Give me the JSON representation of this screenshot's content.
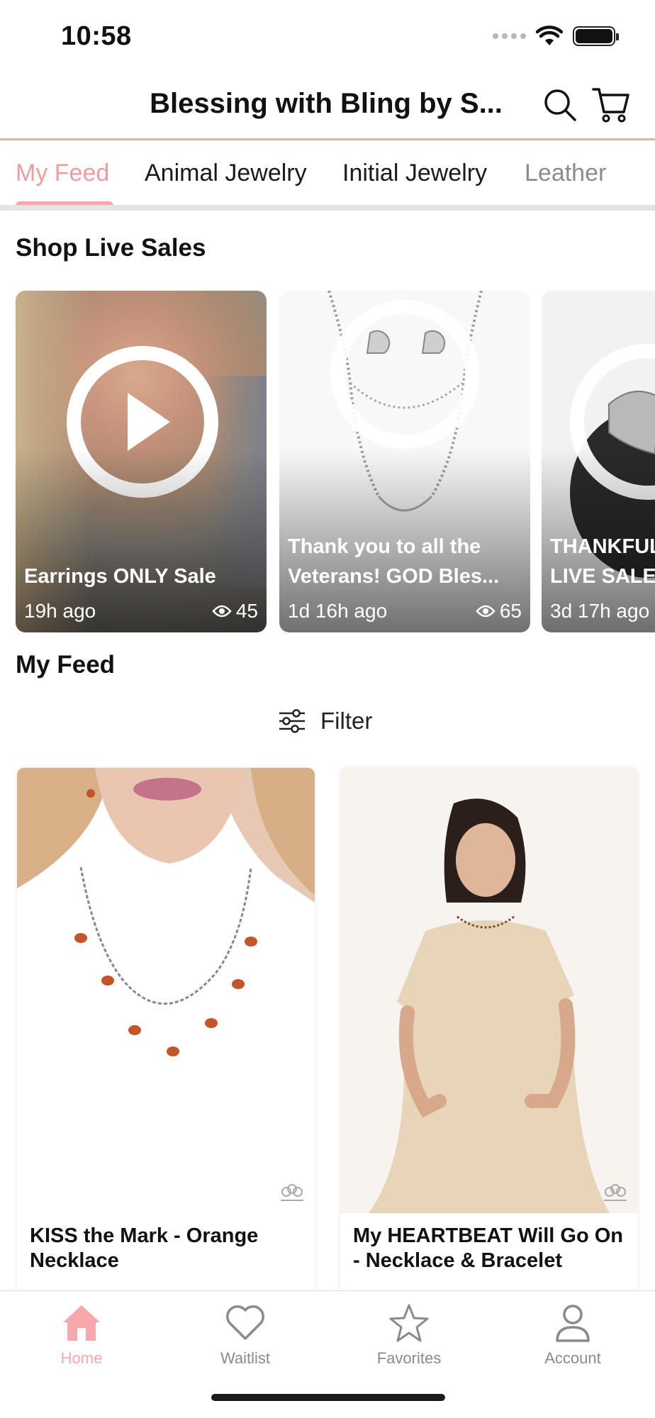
{
  "status_bar": {
    "time": "10:58"
  },
  "header": {
    "store_title": "Blessing with Bling by S...",
    "search_icon": "search-icon",
    "cart_icon": "cart-icon"
  },
  "tabs": [
    {
      "label": "My Feed",
      "active": true
    },
    {
      "label": "Animal Jewelry",
      "active": false
    },
    {
      "label": "Initial Jewelry",
      "active": false
    },
    {
      "label": "Leather",
      "active": false
    }
  ],
  "live_sales": {
    "section_title": "Shop Live Sales",
    "cards": [
      {
        "title_lines": [
          "Earrings ONLY Sale"
        ],
        "time": "19h ago",
        "views": "45"
      },
      {
        "title_lines": [
          "Thank you to all the",
          "Veterans! GOD Bles..."
        ],
        "time": "1d 16h ago",
        "views": "65"
      },
      {
        "title_lines": [
          "THANKFUL",
          "LIVE SALE!"
        ],
        "time": "3d 17h ago",
        "views": ""
      }
    ]
  },
  "feed": {
    "section_title": "My Feed",
    "filter_label": "Filter",
    "products": [
      {
        "name": "KISS the Mark - Orange Necklace"
      },
      {
        "name": "My HEARTBEAT Will Go On - Necklace & Bracelet"
      }
    ]
  },
  "bottom_nav": [
    {
      "label": "Home",
      "icon": "home-icon",
      "active": true
    },
    {
      "label": "Waitlist",
      "icon": "heart-icon",
      "active": false
    },
    {
      "label": "Favorites",
      "icon": "star-icon",
      "active": false
    },
    {
      "label": "Account",
      "icon": "account-icon",
      "active": false
    }
  ],
  "colors": {
    "accent": "#f7a8ad",
    "header_border": "#f3a8ad",
    "inactive": "#8a8a8a"
  }
}
